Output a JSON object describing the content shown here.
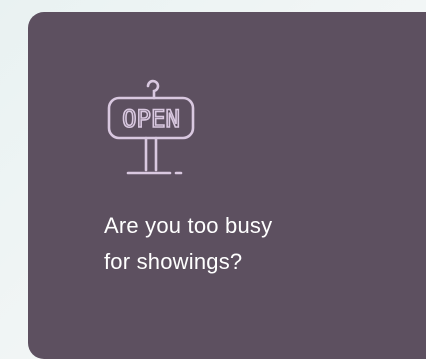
{
  "card": {
    "background": "#5d5060",
    "icon": "open-sign-icon",
    "icon_text": "OPEN",
    "icon_color": "#d9c8e0",
    "headline_line1": "Are you too busy",
    "headline_line2": "for showings?"
  }
}
